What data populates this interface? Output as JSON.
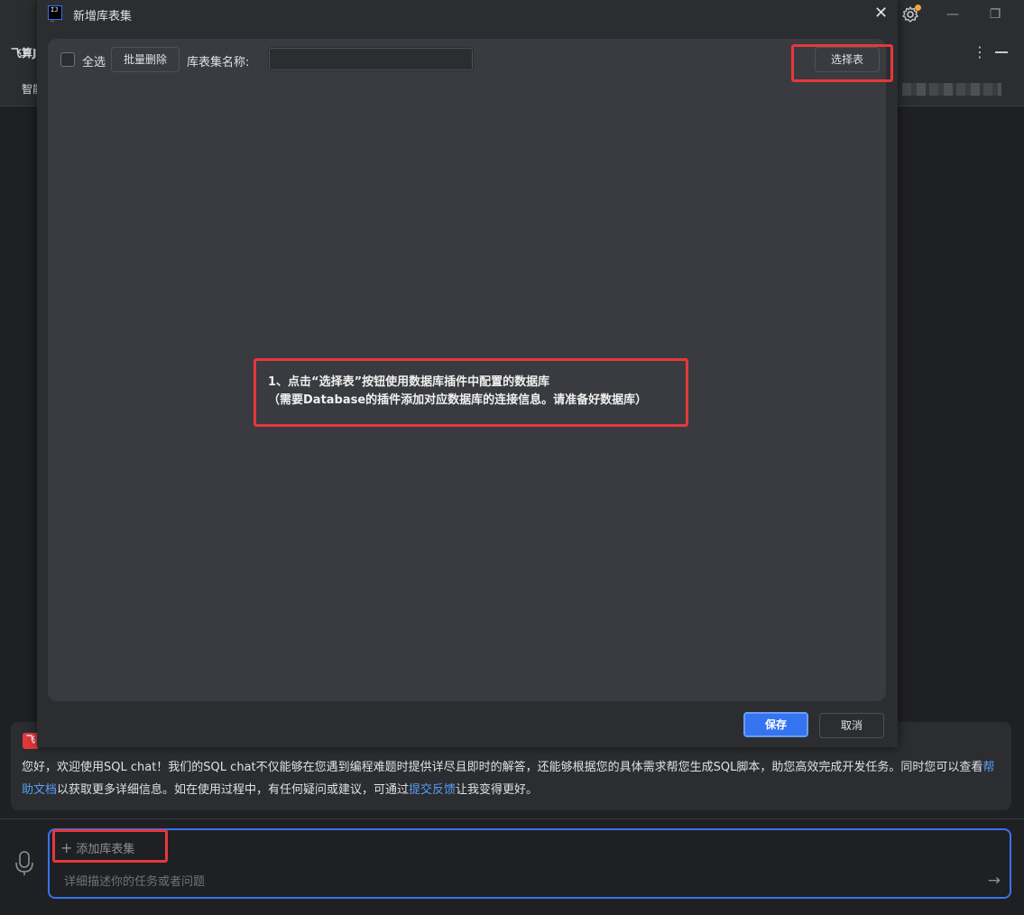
{
  "ide": {
    "panel_title": "飞算J",
    "tab_label": "智能",
    "settings_icon": "gear-icon",
    "window_controls": [
      "minimize-icon",
      "restore-icon"
    ]
  },
  "dialog": {
    "title": "新增库表集",
    "toolbar": {
      "select_all_label": "全选",
      "batch_delete_label": "批量删除",
      "name_label": "库表集名称:",
      "name_value": "",
      "select_table_label": "选择表"
    },
    "annotation": {
      "line1": "1、点击“选择表”按钮使用数据库插件中配置的数据库",
      "line2": "（需要Database的插件添加对应数据库的连接信息。请准备好数据库）"
    },
    "save_label": "保存",
    "cancel_label": "取消"
  },
  "message": {
    "logo_text": "飞算",
    "text_part1": "您好，欢迎使用SQL chat！我们的SQL chat不仅能够在您遇到编程难题时提供详尽且即时的解答，还能够根据您的具体需求帮您生成SQL脚本，助您高效完成开发任务。同时您可以查看",
    "help_link": "帮助文档",
    "text_part2": "以获取更多详细信息。如在使用过程中，有任何疑问或建议，可通过",
    "feedback_link": "提交反馈",
    "text_part3": "让我变得更好。"
  },
  "input": {
    "add_set_label": "添加库表集",
    "placeholder": "详细描述你的任务或者问题"
  },
  "colors": {
    "accent": "#3574f0",
    "annotation_red": "#e5383b",
    "link": "#589df6",
    "notification_dot": "#f0a732"
  }
}
